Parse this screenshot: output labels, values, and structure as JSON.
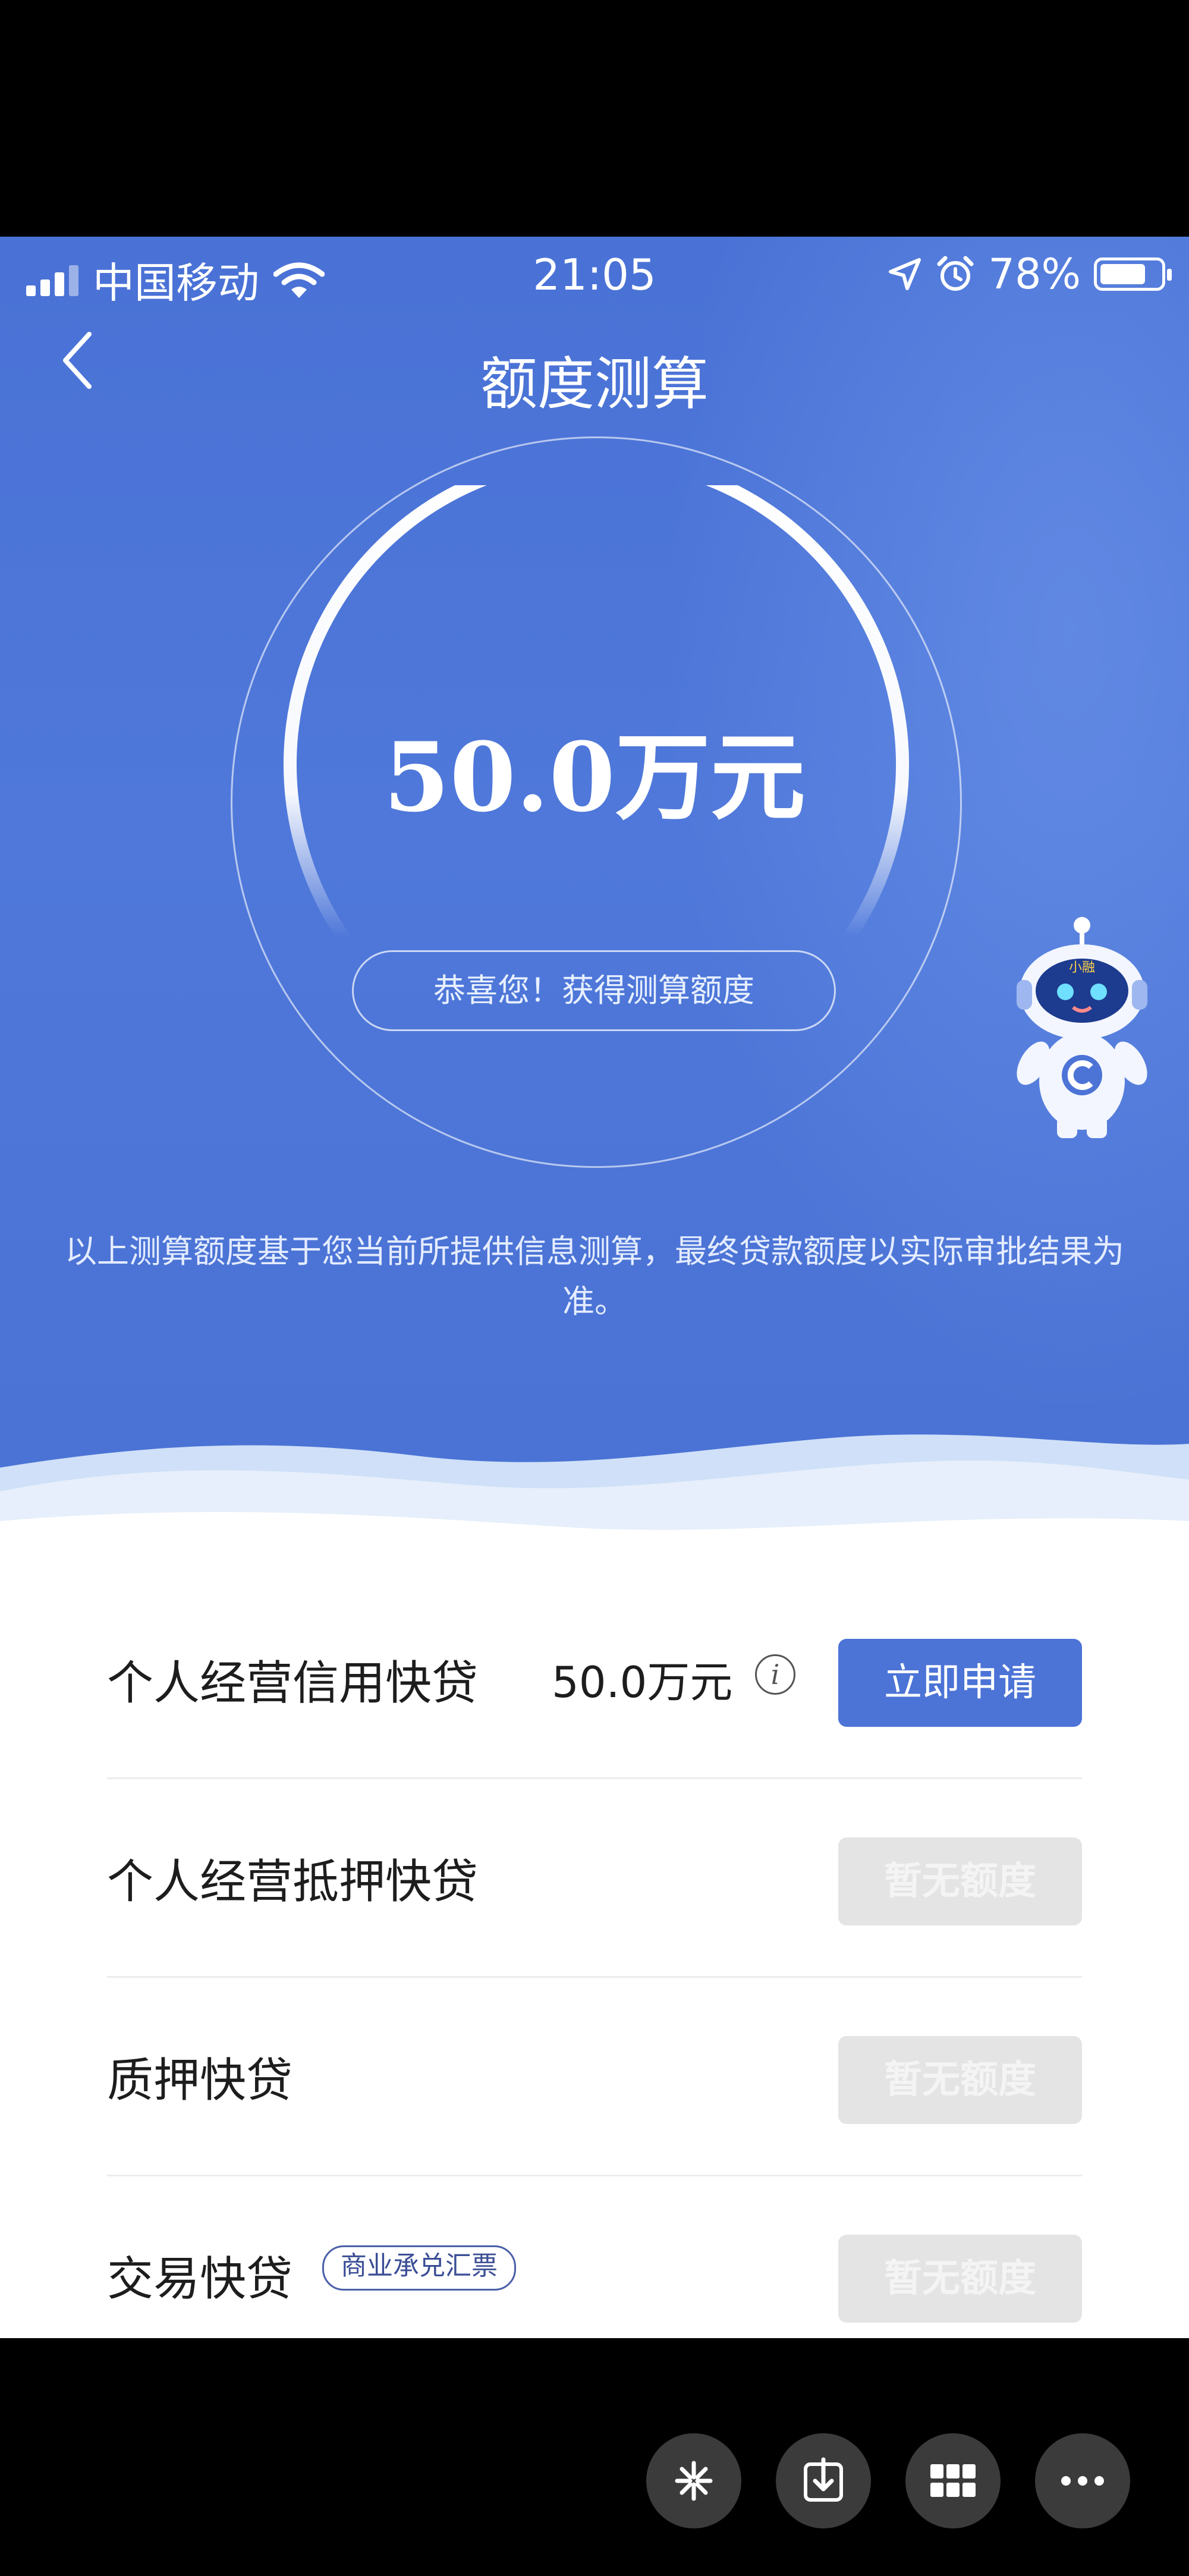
{
  "status_bar": {
    "carrier": "中国移动",
    "time": "21:05",
    "battery": "78%",
    "battery_level": 0.78
  },
  "nav": {
    "title": "额度测算"
  },
  "result": {
    "amount": "50.0万元",
    "congrats": "恭喜您！获得测算额度",
    "robot_label": "小融",
    "disclaimer": "以上测算额度基于您当前所提供信息测算，最终贷款额度以实际审批结果为准。"
  },
  "products": [
    {
      "name": "个人经营信用快贷",
      "amount": "50.0万元",
      "button": "立即申请",
      "enabled": true
    },
    {
      "name": "个人经营抵押快贷",
      "button": "暂无额度",
      "enabled": false
    },
    {
      "name": "质押快贷",
      "button": "暂无额度",
      "enabled": false
    },
    {
      "name": "交易快贷",
      "tag": "商业承兑汇票",
      "button": "暂无额度",
      "enabled": false
    }
  ],
  "colors": {
    "primary": "#4c73d6",
    "hero": "#4a72d6",
    "disabled": "#e4e4e4"
  },
  "toolbar_icons": [
    "sparkle-icon",
    "download-icon",
    "grid-icon",
    "more-icon"
  ]
}
